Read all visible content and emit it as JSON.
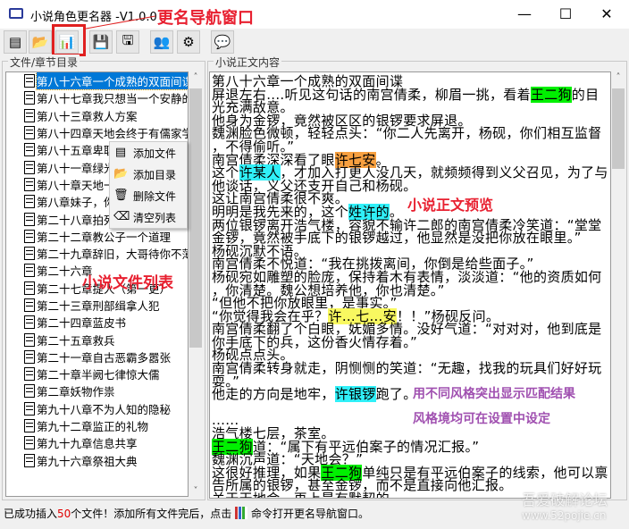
{
  "window": {
    "title": "小说角色更名器  -V1.0.0",
    "minimize": "—",
    "maximize": "☐",
    "close": "✕"
  },
  "toolbar": [
    {
      "name": "add-files",
      "icon": "▤"
    },
    {
      "name": "open-folder",
      "icon": "📂"
    },
    {
      "name": "rename-navigator",
      "icon": "📊"
    },
    {
      "name": "save",
      "icon": "💾"
    },
    {
      "name": "save-as",
      "icon": "🖫"
    },
    {
      "name": "roles",
      "icon": "👥"
    },
    {
      "name": "settings",
      "icon": "⚙"
    },
    {
      "name": "about",
      "icon": "💬"
    }
  ],
  "left_panel": {
    "label": "文件/章节目录",
    "items": [
      "第八十六章一个成熟的双面间谍",
      "第八十七章我只想当一个安静的",
      "第八十三章救人方案",
      "第八十四章天地会终于有儒家学",
      "第八十五章卑职",
      "第八十一章绿光",
      "第八十章天地一",
      "第八章妹子，你",
      "第二十八章拍死",
      "第二十二章教公子一个道理",
      "第二十九章辞旧，大哥待你不薄",
      "第二十六章",
      "第二十七章提人（第一更）",
      "第二十三章刑部缉拿人犯",
      "第二十四章蓝皮书",
      "第二十五章救兵",
      "第二十一章自古恶霸多嚣张",
      "第二十章半阙七律惊大儒",
      "第二章妖物作祟",
      "第九十八章不为人知的隐秘",
      "第九十二章监正的礼物",
      "第九十九章信息共享",
      "第九十六章祭祖大典"
    ]
  },
  "context_menu": [
    {
      "label": "添加文件",
      "icon": "▤"
    },
    {
      "label": "添加目录",
      "icon": "📂"
    },
    {
      "label": "删除文件",
      "icon": "🗑"
    },
    {
      "label": "清空列表",
      "icon": "⌫"
    }
  ],
  "right_panel": {
    "label": "小说正文内容",
    "lines": [
      [
        {
          "t": "第八十六章一个成熟的双面间谍"
        }
      ],
      [
        {
          "t": "屏退左右....听见这句话的南宫倩柔，柳眉一挑，看着"
        },
        {
          "t": "王二狗",
          "hl": "#00f000"
        },
        {
          "t": "的目"
        }
      ],
      [
        {
          "t": "光充满敌意。"
        }
      ],
      [
        {
          "t": "他身为金锣，竟然被区区的银锣要求屏退。"
        }
      ],
      [
        {
          "t": "魏渊脸色微顿，轻轻点头：“你二人先离开，杨砚，你们相互监督"
        }
      ],
      [
        {
          "t": "，不得偷听。”"
        }
      ],
      [
        {
          "t": "南宫倩柔深深看了眼"
        },
        {
          "t": "许七安",
          "hl": "#f7a040"
        },
        {
          "t": "。"
        }
      ],
      [
        {
          "t": "这个"
        },
        {
          "t": "许某人",
          "hl": "#30f0f8"
        },
        {
          "t": "，才加入打更人没几天，就频频得到义父召见，为了与"
        }
      ],
      [
        {
          "t": "他谈话，义父还支开自己和杨砚。"
        }
      ],
      [
        {
          "t": "这让南宫倩柔很不爽。"
        }
      ],
      [
        {
          "t": "明明是我先来的，这个"
        },
        {
          "t": "姓许的",
          "hl": "#30f0f8"
        },
        {
          "t": "。"
        }
      ],
      [
        {
          "t": "两位银锣离开浩气楼，容貌不输许二郎的南宫倩柔冷笑道：“堂堂"
        }
      ],
      [
        {
          "t": "金锣，竟然被手底下的银锣越过，他显然是没把你放在眼里。”"
        }
      ],
      [
        {
          "t": "杨砚沉默不语。"
        }
      ],
      [
        {
          "t": "南宫倩柔不悦道：“我在挑拨离间，你倒是给些面子。”"
        }
      ],
      [
        {
          "t": "杨砚宛如雕塑的脸庞，保持着木有表情，淡淡道：“他的资质如何"
        }
      ],
      [
        {
          "t": "，你清楚。魏公想培养他，你也清楚。”"
        }
      ],
      [
        {
          "t": "“但他不把你放眼里，是事实。”"
        }
      ],
      [
        {
          "t": "“你觉得我会在乎？"
        },
        {
          "t": "许…七…安",
          "hl": "#f8f860"
        },
        {
          "t": "！！”杨砚反问。"
        }
      ],
      [
        {
          "t": "南宫倩柔翻了个白眼，妩媚多情。没好气道：“对对对，他到底是"
        }
      ],
      [
        {
          "t": "你手底下的兵，这份香火情存着。”"
        }
      ],
      [
        {
          "t": "杨砚点点头。"
        }
      ],
      [
        {
          "t": "南宫倩柔转身就走，阴恻恻的笑道：“无趣，找我的玩具们好好玩"
        }
      ],
      [
        {
          "t": "耍。”"
        }
      ],
      [
        {
          "t": "他走的方向是地牢，"
        },
        {
          "t": "许银锣",
          "hl": "#30f0f8"
        },
        {
          "t": "跑了。"
        }
      ],
      [
        {
          "t": ""
        }
      ],
      [
        {
          "t": "......"
        }
      ],
      [
        {
          "t": "浩气楼七层，茶室。"
        }
      ],
      [
        {
          "t": "王二狗",
          "hl": "#00f000"
        },
        {
          "t": "道：“属下有平远伯案子的情况汇报。”"
        }
      ],
      [
        {
          "t": "魏渊沉声道：“天地会？”"
        }
      ],
      [
        {
          "t": "这很好推理，如果"
        },
        {
          "t": "王二狗",
          "hl": "#00f000"
        },
        {
          "t": "单纯只是有平远伯案子的线索，他可以禀"
        }
      ],
      [
        {
          "t": "告所属的银锣，甚至金锣，而不是直接向他汇报。"
        }
      ],
      [
        {
          "t": "关于天地会，再上是有默契的"
        }
      ]
    ]
  },
  "status": {
    "part1": "已成功插入",
    "count": "50",
    "part2": "个文件！添加所有文件完后，点击",
    "part3": "命令打开更名导航窗口。"
  },
  "annotations": {
    "nav": "更名导航窗口",
    "list": "小说文件列表",
    "preview": "小说正文预览",
    "match": "用不同风格突出显示匹配结果",
    "style": "风格境均可在设置中设定"
  },
  "watermark": {
    "line1": "吾爱破解论坛",
    "line2": "www.52pojie.cn"
  }
}
